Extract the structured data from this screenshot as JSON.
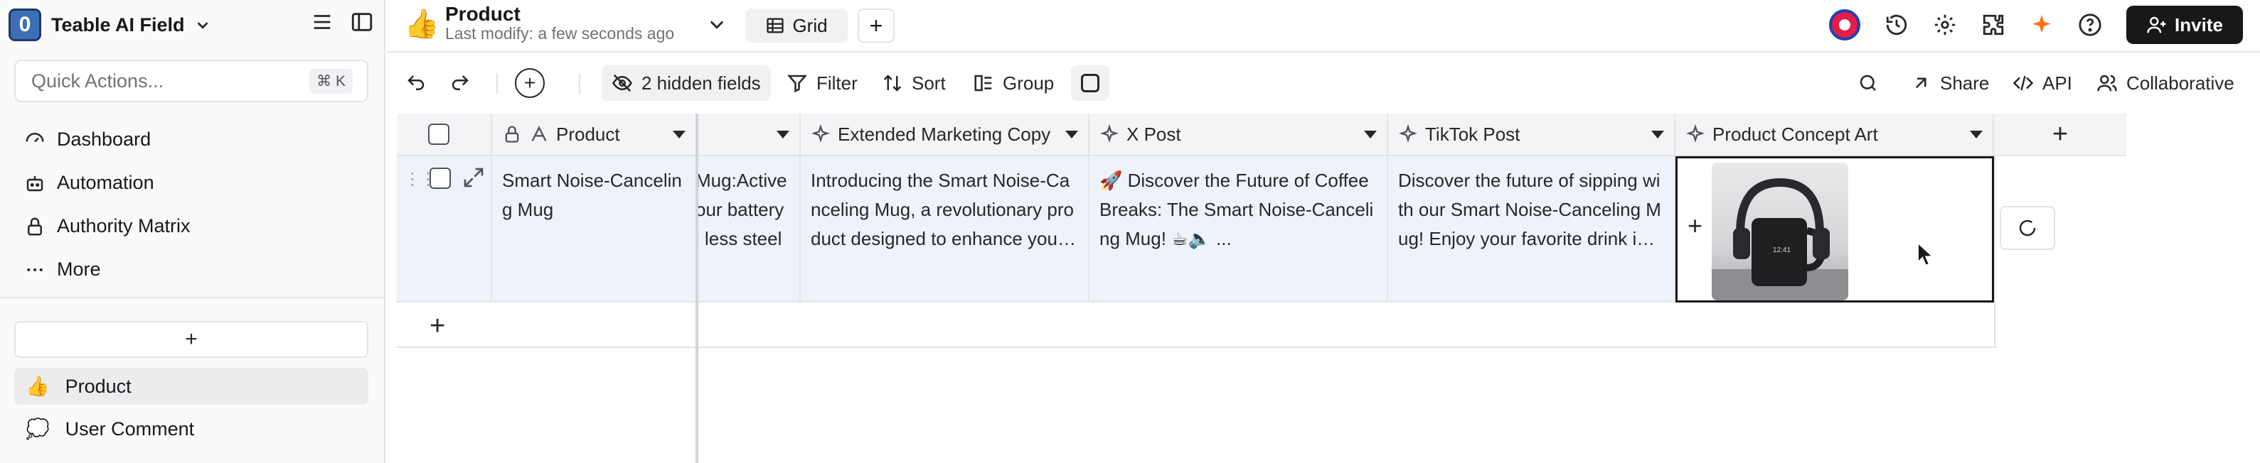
{
  "sidebar": {
    "space_initial": "0",
    "space_name": "Teable AI Field",
    "quick_actions_placeholder": "Quick Actions...",
    "quick_actions_shortcut": "⌘ K",
    "nav": [
      {
        "label": "Dashboard",
        "icon": "dashboard-icon"
      },
      {
        "label": "Automation",
        "icon": "bot-icon"
      },
      {
        "label": "Authority Matrix",
        "icon": "lock-icon"
      },
      {
        "label": "More",
        "icon": "more-icon"
      }
    ],
    "add_table_label": "+",
    "tables": [
      {
        "emoji": "👍",
        "name": "Product",
        "active": true
      },
      {
        "emoji": "💭",
        "name": "User Comment",
        "active": false
      }
    ]
  },
  "header": {
    "table_emoji": "👍",
    "table_name": "Product",
    "last_modify": "Last modify: a few seconds ago",
    "view_label": "Grid",
    "add_view": "+",
    "invite_label": "Invite"
  },
  "toolbar": {
    "add": "+",
    "hidden_fields": "2 hidden fields",
    "filter": "Filter",
    "sort": "Sort",
    "group": "Group",
    "share": "Share",
    "api": "API",
    "collaborative": "Collaborative"
  },
  "grid": {
    "columns": [
      {
        "name": "Product",
        "icon": "text-icon",
        "locked": true
      },
      {
        "name": "",
        "icon": "",
        "partial": true
      },
      {
        "name": "Extended Marketing Copy",
        "icon": "ai-sparkle-icon"
      },
      {
        "name": "X Post",
        "icon": "ai-sparkle-icon"
      },
      {
        "name": "TikTok Post",
        "icon": "ai-sparkle-icon"
      },
      {
        "name": "Product Concept Art",
        "icon": "ai-sparkle-icon"
      }
    ],
    "row": {
      "product": "Smart Noise-Canceling Mug",
      "partial": "Mug:Active our battery l less steel",
      "extended_copy": "Introducing the Smart Noise-Canceling Mug, a revolutionary product designed to enhance your beverage experience with cutting...",
      "x_post": "🚀 Discover the Future of Coffee Breaks: The Smart Noise-Canceling Mug! ☕🔈 ...",
      "tiktok_post": "Discover the future of sipping with our Smart Noise-Canceling Mug! Enjoy your favorite drink in peace, anywhere, anytime. Perf...",
      "concept_art": "mug-with-headphones-image"
    },
    "add_row": "+",
    "add_column": "+"
  },
  "colors": {
    "accent_dark": "#18181b",
    "row_highlight": "#eef3fb",
    "header_bg": "#f4f4f6",
    "logo_blue": "#3b6fb6"
  }
}
